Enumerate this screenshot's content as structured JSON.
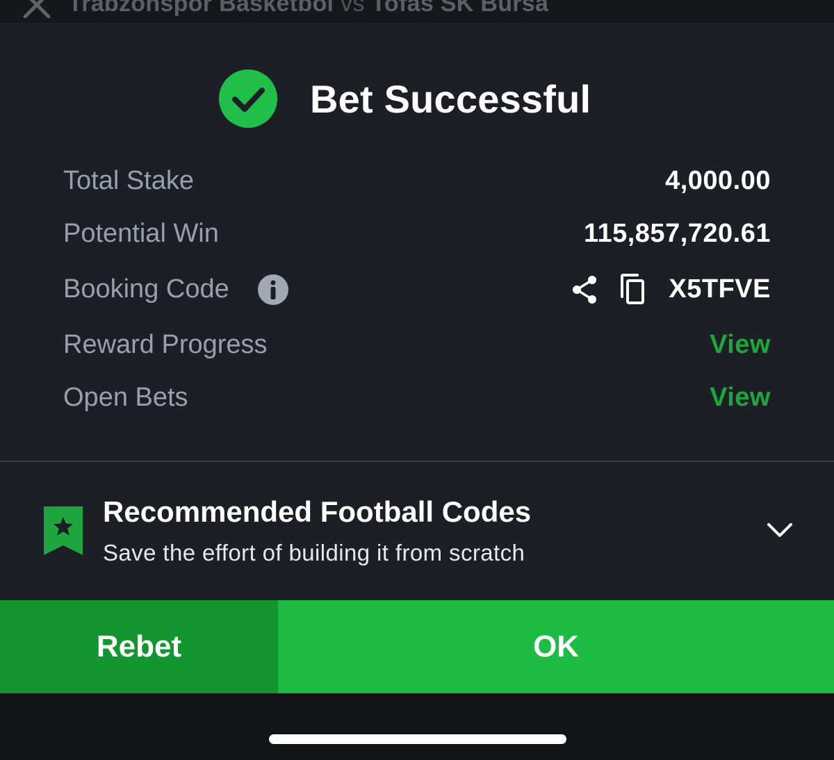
{
  "header": {
    "home_team": "Trabzonspor Basketbol",
    "vs": "vs",
    "away_team": "Tofas SK Bursa",
    "close_icon": "close-icon"
  },
  "result": {
    "title": "Bet Successful",
    "icon": "checkmark-circle-icon",
    "accent": "#1fbf4a"
  },
  "details": {
    "total_stake_label": "Total Stake",
    "total_stake_value": "4,000.00",
    "potential_win_label": "Potential Win",
    "potential_win_value": "115,857,720.61",
    "booking_code_label": "Booking Code",
    "booking_code_value": "X5TFVE",
    "reward_progress_label": "Reward Progress",
    "reward_progress_link": "View",
    "open_bets_label": "Open Bets",
    "open_bets_link": "View"
  },
  "recommended": {
    "title": "Recommended Football Codes",
    "subtitle": "Save the effort of building it from scratch"
  },
  "actions": {
    "rebet_label": "Rebet",
    "ok_label": "OK"
  },
  "colors": {
    "panel_bg": "#1c1f26",
    "link_green": "#1fa53d",
    "rebet_bg": "#13952f",
    "ok_bg": "#1cbc45"
  }
}
